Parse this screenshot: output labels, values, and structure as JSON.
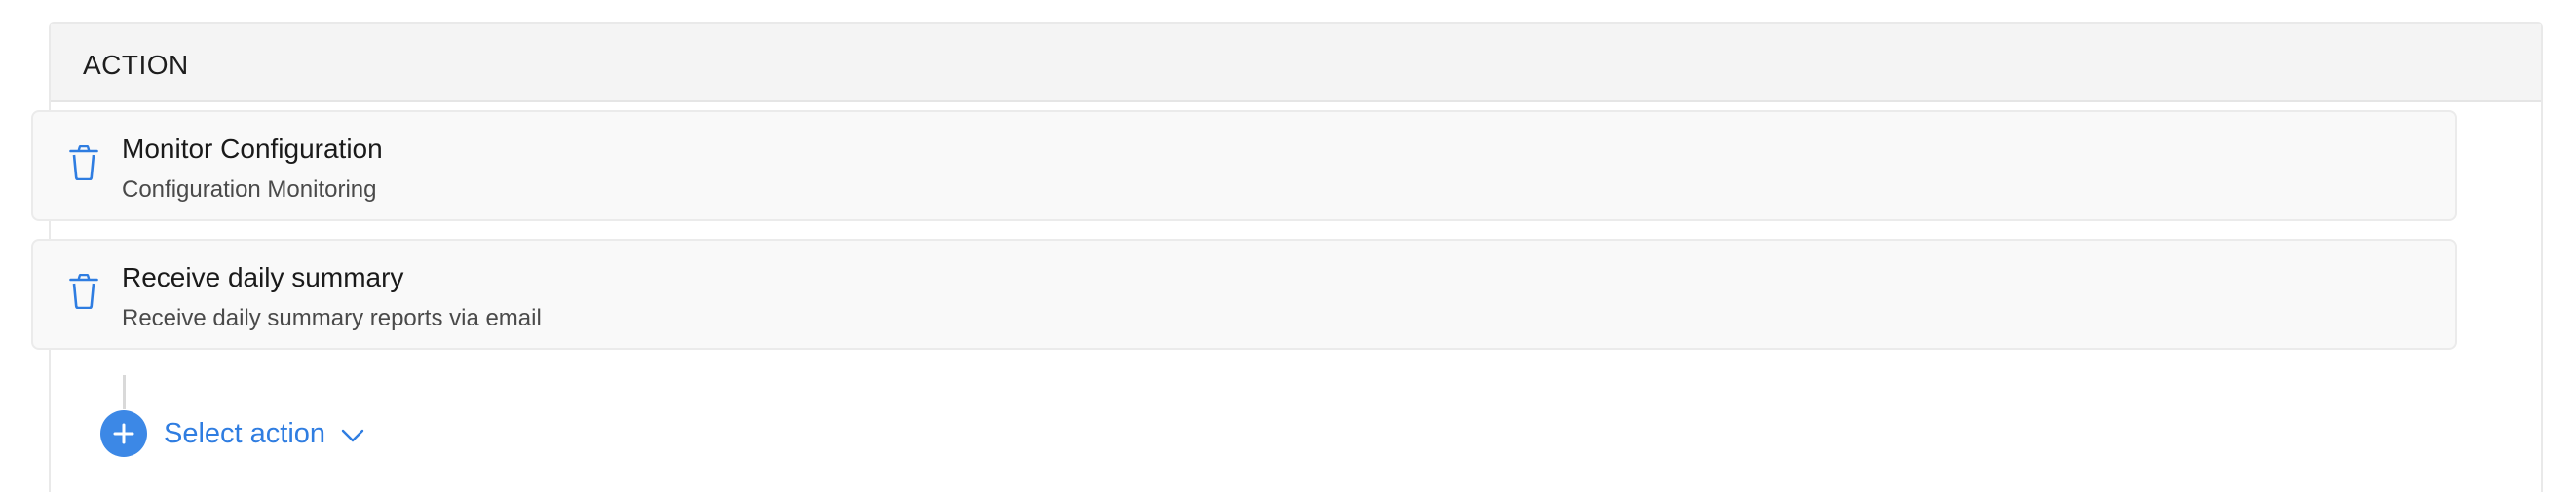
{
  "section": {
    "title": "ACTION"
  },
  "actions": [
    {
      "title": "Monitor Configuration",
      "subtitle": "Configuration Monitoring",
      "icon": "trash-icon"
    },
    {
      "title": "Receive daily summary",
      "subtitle": "Receive daily summary reports via email",
      "icon": "trash-icon"
    }
  ],
  "add_action": {
    "label": "Select action",
    "icon": "plus-circle-icon",
    "dropdown_icon": "chevron-down-icon"
  },
  "colors": {
    "accent": "#3c88e6",
    "link": "#2f7de1",
    "header_bg": "#f4f4f4",
    "card_bg": "#f9f9f9"
  }
}
